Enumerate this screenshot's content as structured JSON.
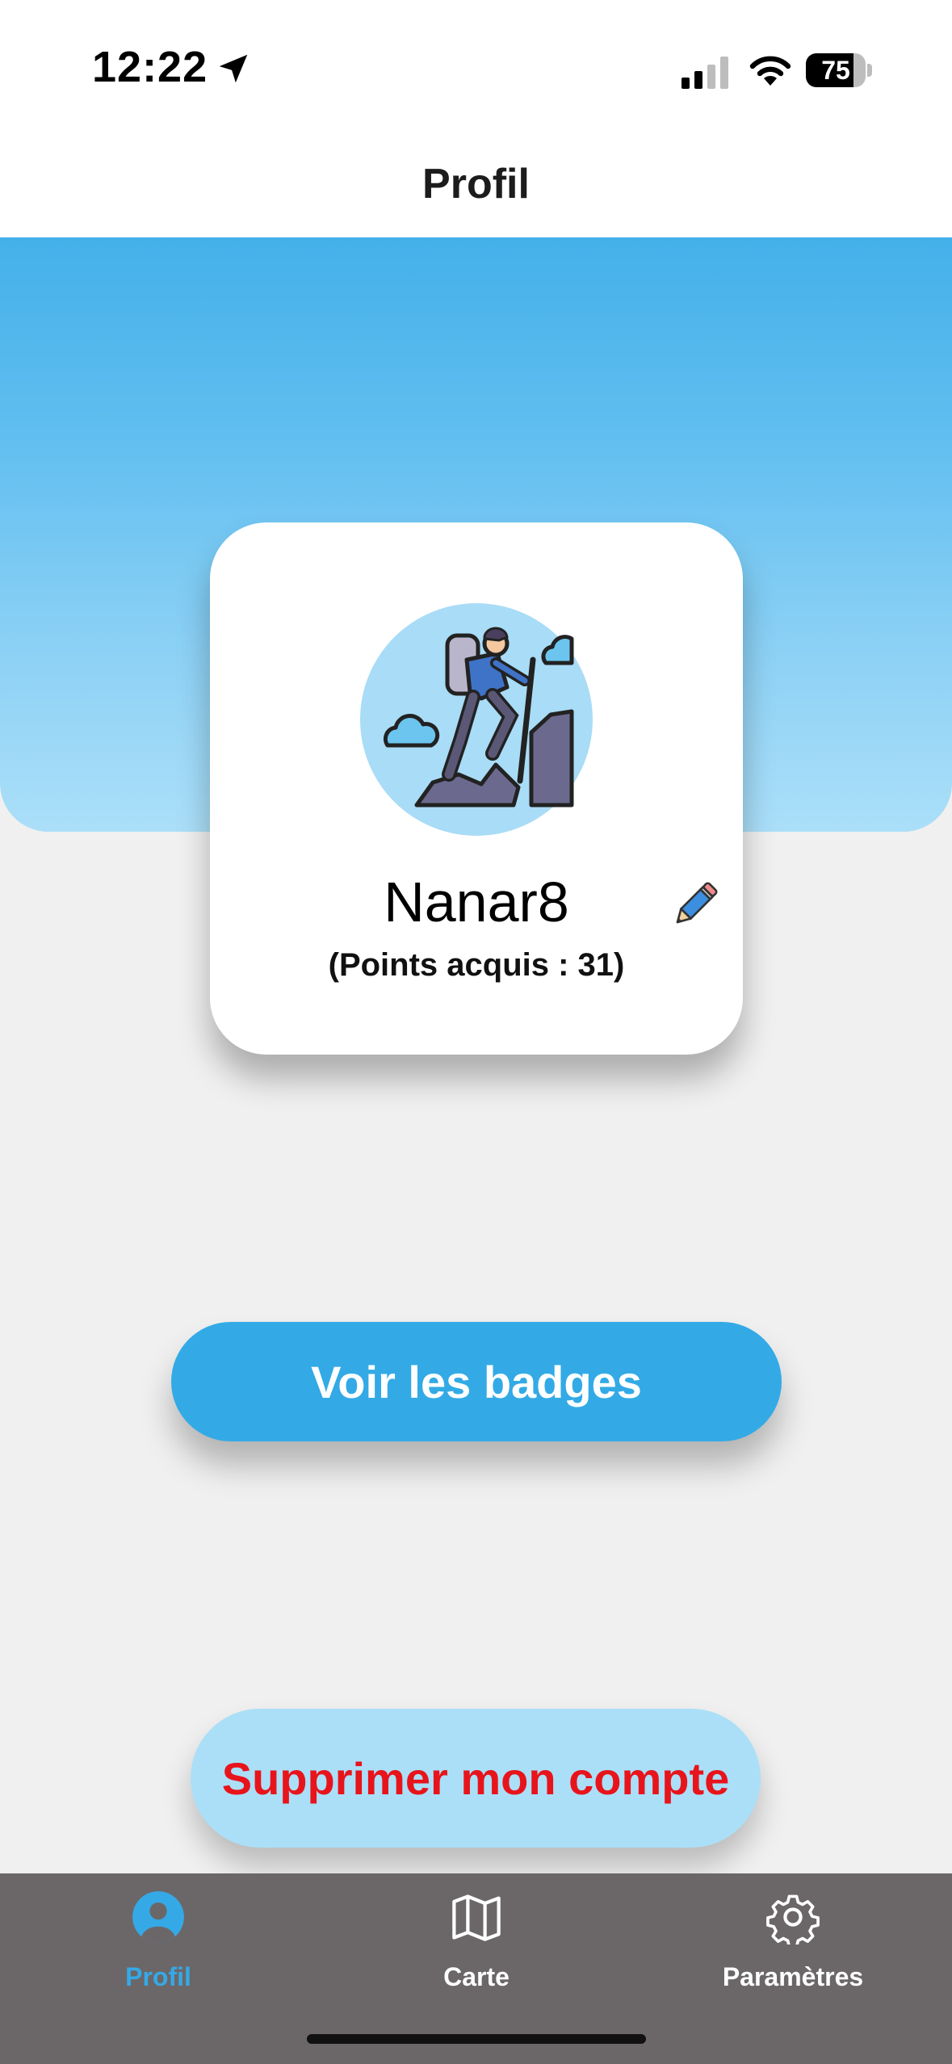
{
  "status_bar": {
    "time": "12:22",
    "battery": "75",
    "icons": [
      "location-arrow-icon",
      "signal-icon",
      "wifi-icon",
      "battery-icon"
    ]
  },
  "header": {
    "title": "Profil"
  },
  "profile": {
    "username": "Nanar8",
    "points": "(Points acquis : 31)",
    "avatar_icon": "hiker-climbing-icon",
    "edit_icon": "pencil-icon"
  },
  "actions": {
    "badges_label": "Voir les badges",
    "delete_label": "Supprimer mon compte"
  },
  "tabs": [
    {
      "label": "Profil",
      "icon": "user-circle-icon",
      "active": true
    },
    {
      "label": "Carte",
      "icon": "map-icon",
      "active": false
    },
    {
      "label": "Paramètres",
      "icon": "gear-icon",
      "active": false
    }
  ],
  "colors": {
    "accent": "#33aae6",
    "danger": "#e8141b",
    "tab_bar": "#6b6768",
    "hero_top": "#44b0e9",
    "hero_bottom": "#abdff9"
  }
}
